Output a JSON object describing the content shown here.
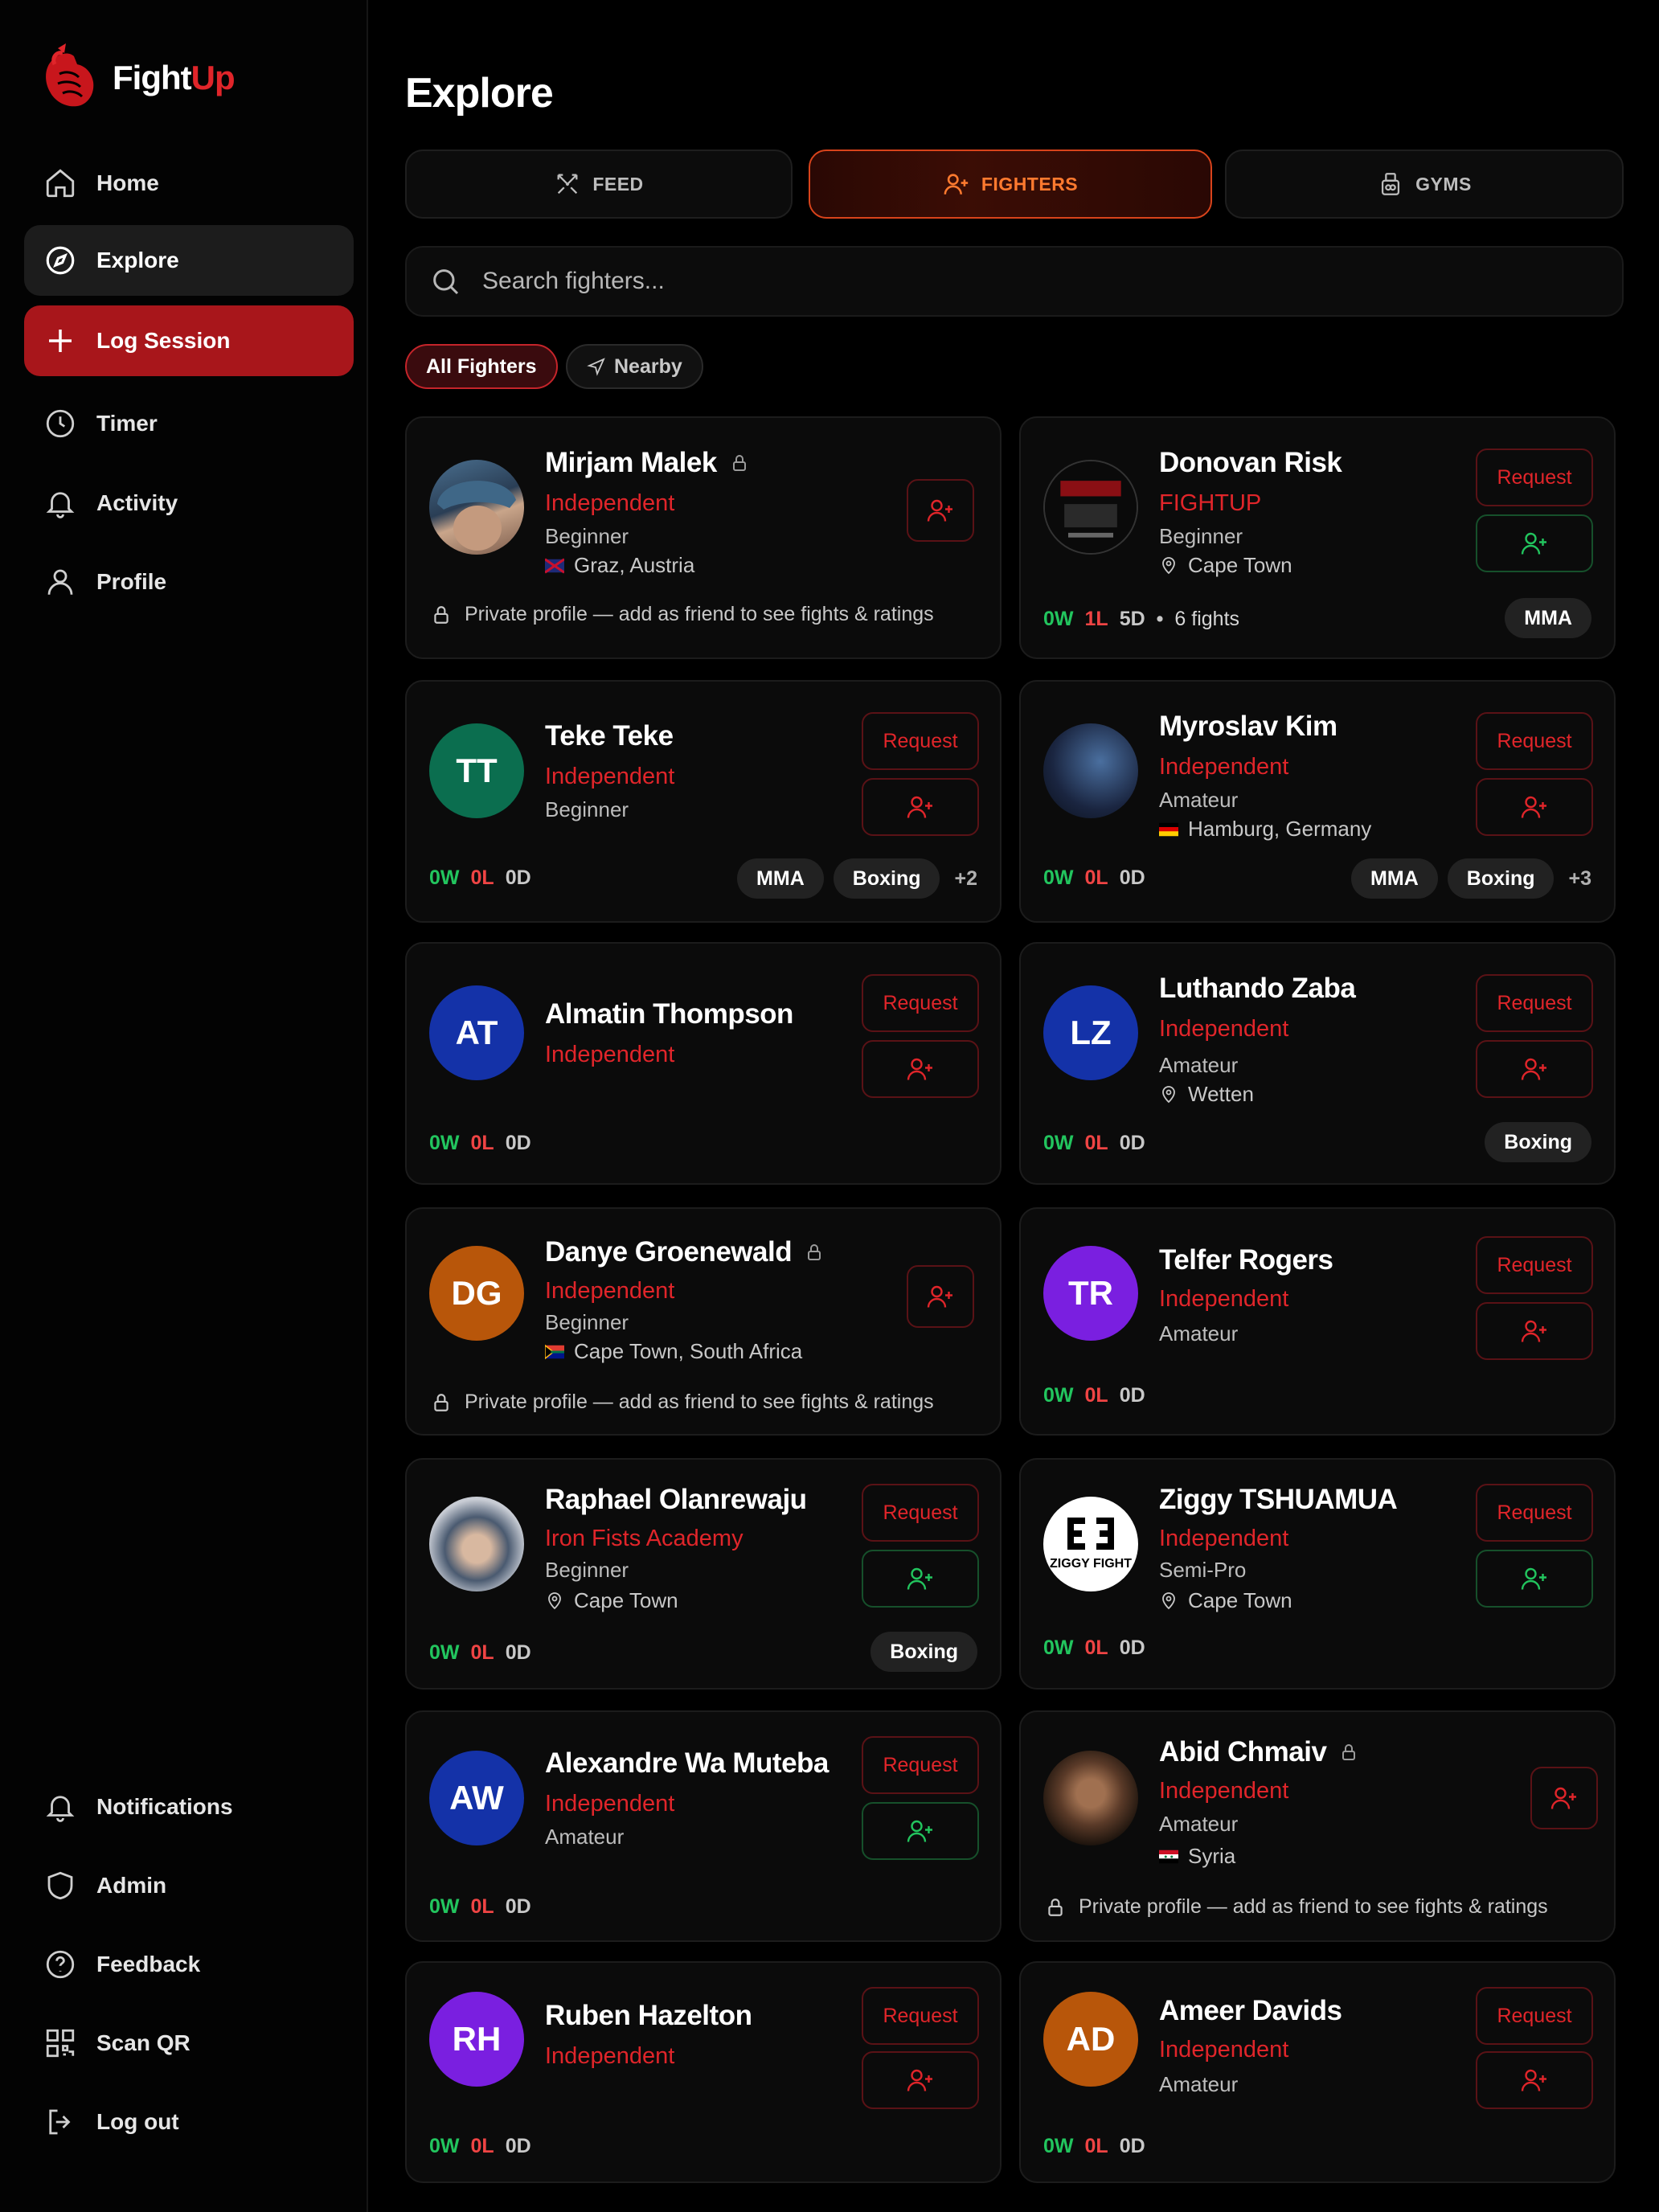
{
  "app": {
    "name_part1": "Fight",
    "name_part2": "Up"
  },
  "sidebar": {
    "items": [
      {
        "label": "Home",
        "icon": "home-icon"
      },
      {
        "label": "Explore",
        "icon": "compass-icon"
      },
      {
        "label": "Log Session",
        "icon": "plus-icon"
      },
      {
        "label": "Timer",
        "icon": "clock-icon"
      },
      {
        "label": "Activity",
        "icon": "bell-icon"
      },
      {
        "label": "Profile",
        "icon": "user-icon"
      }
    ],
    "bottom": [
      {
        "label": "Notifications",
        "icon": "bell-icon"
      },
      {
        "label": "Admin",
        "icon": "shield-icon"
      },
      {
        "label": "Feedback",
        "icon": "help-circle-icon"
      },
      {
        "label": "Scan QR",
        "icon": "qr-icon"
      },
      {
        "label": "Log out",
        "icon": "logout-icon"
      }
    ]
  },
  "page": {
    "title": "Explore"
  },
  "tabs": [
    {
      "label": "FEED",
      "icon": "swords-icon"
    },
    {
      "label": "FIGHTERS",
      "icon": "user-plus-icon",
      "active": true
    },
    {
      "label": "GYMS",
      "icon": "gym-icon"
    }
  ],
  "search": {
    "placeholder": "Search fighters..."
  },
  "filters": {
    "all": "All Fighters",
    "nearby": "Nearby"
  },
  "labels": {
    "request": "Request",
    "private": "Private profile — add as friend to see fights & ratings"
  },
  "fighters": [
    {
      "name": "Mirjam Malek",
      "gym": "Independent",
      "level": "Beginner",
      "location": "Graz, Austria",
      "private": true
    },
    {
      "name": "Donovan Risk",
      "gym": "FIGHTUP",
      "level": "Beginner",
      "location": "Cape Town",
      "w": "0W",
      "l": "1L",
      "d": "5D",
      "fights": "6 fights",
      "tags": [
        "MMA"
      ]
    },
    {
      "name": "Teke Teke",
      "initials": "TT",
      "gym": "Independent",
      "level": "Beginner",
      "w": "0W",
      "l": "0L",
      "d": "0D",
      "tags": [
        "MMA",
        "Boxing"
      ],
      "more": "+2"
    },
    {
      "name": "Myroslav Kim",
      "gym": "Independent",
      "level": "Amateur",
      "location": "Hamburg, Germany",
      "w": "0W",
      "l": "0L",
      "d": "0D",
      "tags": [
        "MMA",
        "Boxing"
      ],
      "more": "+3"
    },
    {
      "name": "Almatin Thompson",
      "initials": "AT",
      "gym": "Independent",
      "w": "0W",
      "l": "0L",
      "d": "0D"
    },
    {
      "name": "Luthando Zaba",
      "initials": "LZ",
      "gym": "Independent",
      "level": "Amateur",
      "location": "Wetten",
      "w": "0W",
      "l": "0L",
      "d": "0D",
      "tags": [
        "Boxing"
      ]
    },
    {
      "name": "Danye Groenewald",
      "initials": "DG",
      "gym": "Independent",
      "level": "Beginner",
      "location": "Cape Town, South Africa",
      "private": true
    },
    {
      "name": "Telfer Rogers",
      "initials": "TR",
      "gym": "Independent",
      "level": "Amateur",
      "w": "0W",
      "l": "0L",
      "d": "0D"
    },
    {
      "name": "Raphael Olanrewaju",
      "gym": "Iron Fists Academy",
      "level": "Beginner",
      "location": "Cape Town",
      "w": "0W",
      "l": "0L",
      "d": "0D",
      "tags": [
        "Boxing"
      ]
    },
    {
      "name": "Ziggy TSHUAMUA",
      "gym": "Independent",
      "level": "Semi-Pro",
      "location": "Cape Town",
      "w": "0W",
      "l": "0L",
      "d": "0D",
      "avatar_text": "ZIGGY FIGHT"
    },
    {
      "name": "Alexandre Wa Muteba",
      "initials": "AW",
      "gym": "Independent",
      "level": "Amateur",
      "w": "0W",
      "l": "0L",
      "d": "0D"
    },
    {
      "name": "Abid Chmaiv",
      "gym": "Independent",
      "level": "Amateur",
      "location": "Syria",
      "private": true
    },
    {
      "name": "Ruben Hazelton",
      "initials": "RH",
      "gym": "Independent",
      "w": "0W",
      "l": "0L",
      "d": "0D"
    },
    {
      "name": "Ameer Davids",
      "initials": "AD",
      "gym": "Independent",
      "level": "Amateur",
      "w": "0W",
      "l": "0L",
      "d": "0D"
    }
  ],
  "colors": {
    "accent": "#e0252a",
    "orange": "#ff7a2f",
    "win": "#22c55e",
    "loss": "#ef4444",
    "bg": "#000000"
  }
}
